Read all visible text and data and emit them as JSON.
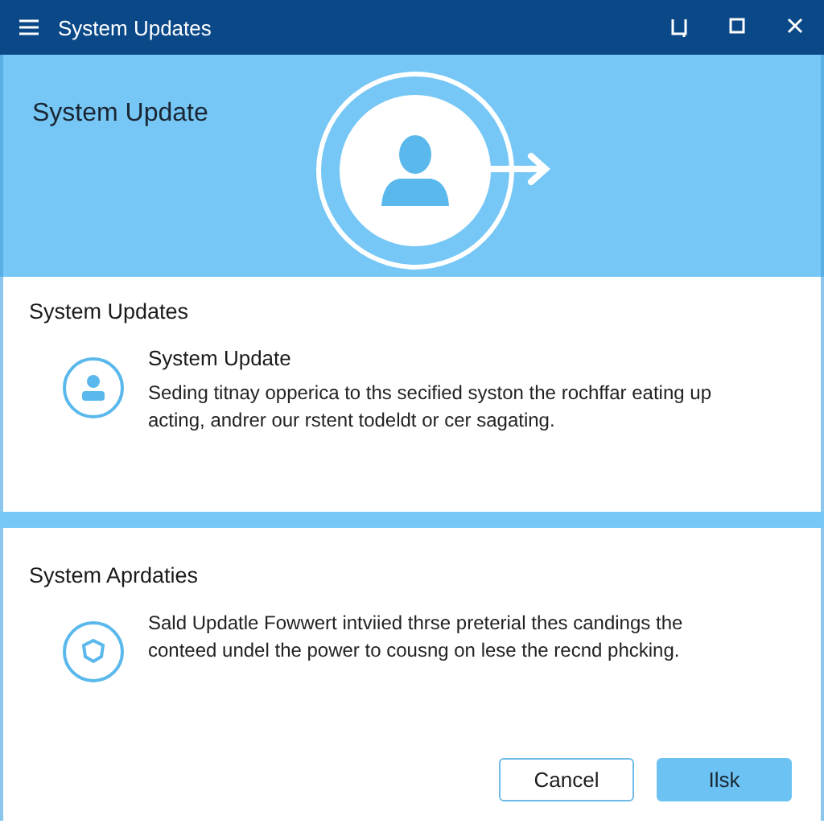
{
  "window": {
    "title": "System Updates"
  },
  "hero": {
    "title": "System Update"
  },
  "sections": [
    {
      "heading": "System Updates",
      "kind": "person",
      "item_title": "System Update",
      "text": "Seding titnay opperica to ths secified syston the rochffar eating up acting, andrer our rstent todeldt or cer sagating."
    },
    {
      "heading": "System Aprdaties",
      "kind": "shield",
      "text": "Sald Updatle Fowwert intviied thrse preterial thes candings the conteed undel the power to cousng on lese the recnd phcking."
    }
  ],
  "buttons": [
    {
      "label": "Cancel",
      "kind": "secondary"
    },
    {
      "label": "Ilsk",
      "kind": "primary"
    }
  ]
}
